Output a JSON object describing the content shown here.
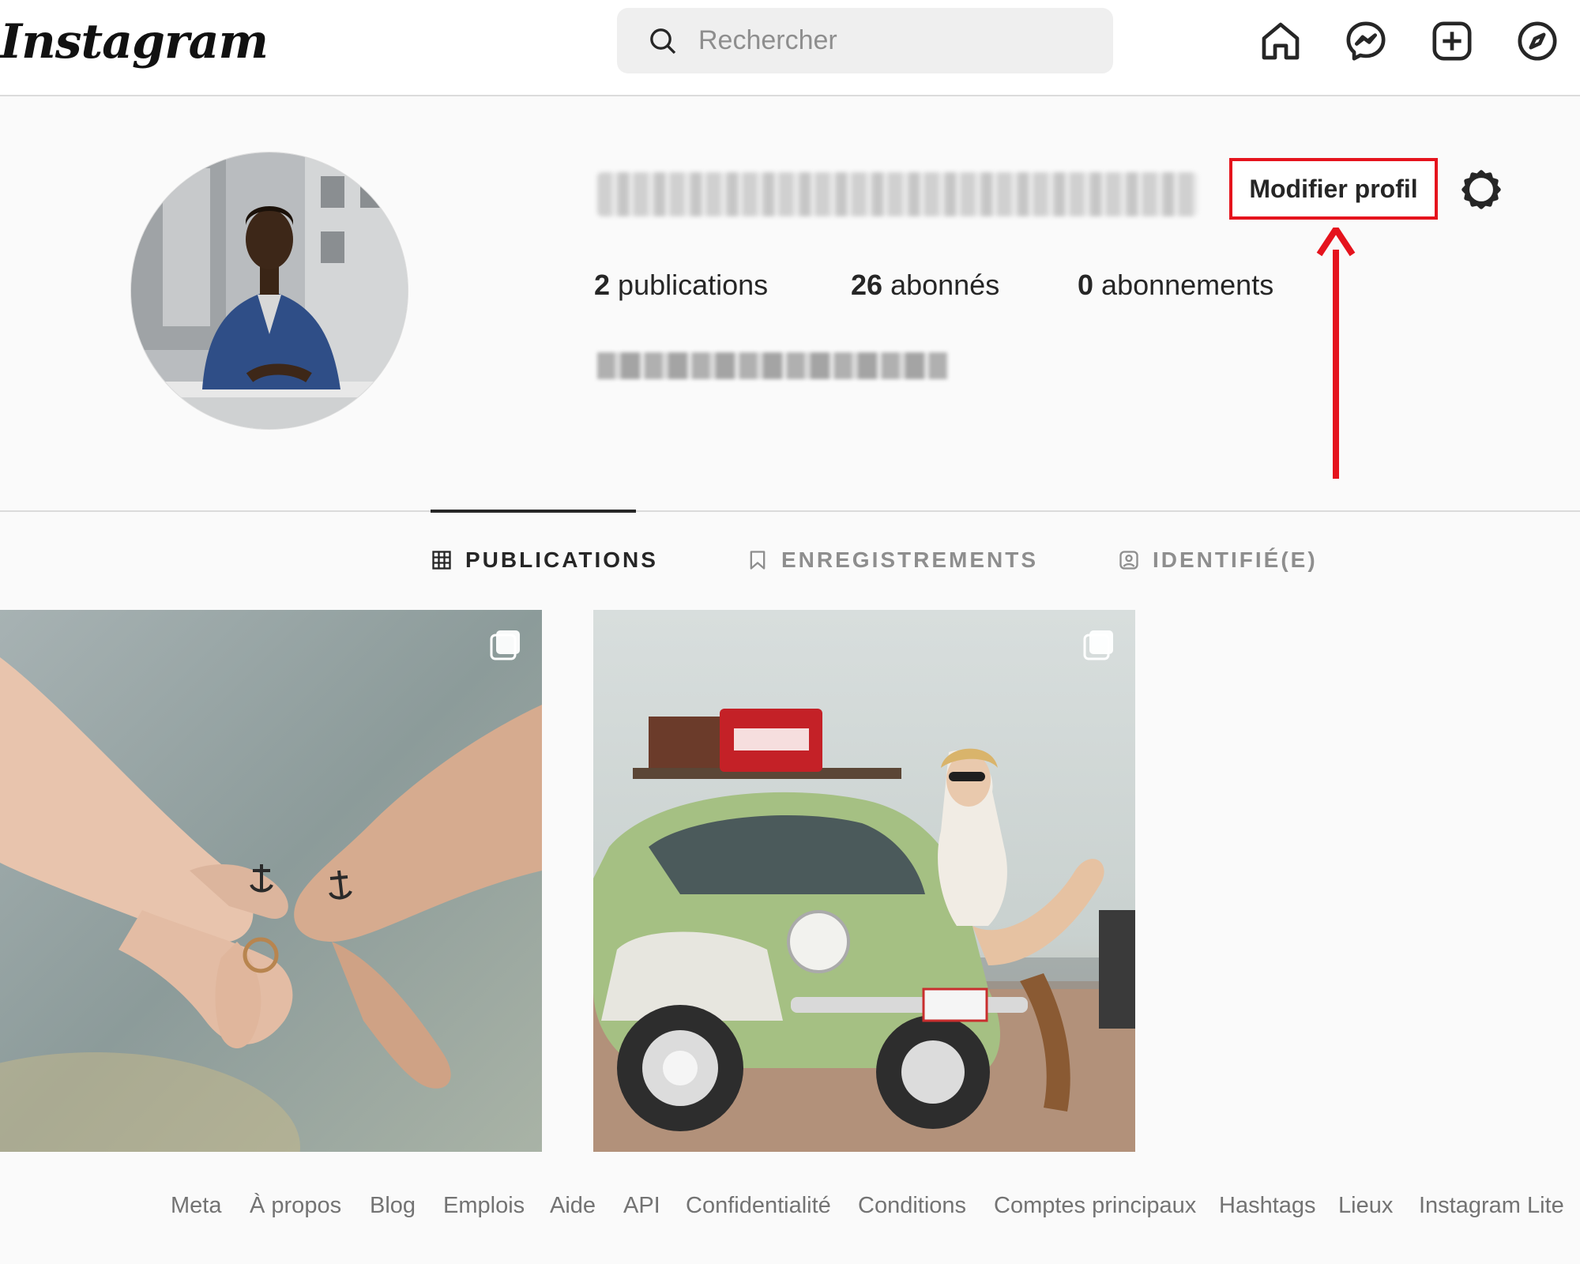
{
  "header": {
    "logo_text": "Instagram",
    "search_placeholder": "Rechercher",
    "nav_icons": [
      "home-icon",
      "messenger-icon",
      "new-post-icon",
      "explore-icon"
    ]
  },
  "profile": {
    "edit_button_label": "Modifier profil",
    "stats": [
      {
        "count": "2",
        "label": "publications"
      },
      {
        "count": "26",
        "label": "abonnés"
      },
      {
        "count": "0",
        "label": "abonnements"
      }
    ]
  },
  "tabs": [
    {
      "label": "PUBLICATIONS",
      "icon": "grid-icon",
      "active": true
    },
    {
      "label": "ENREGISTREMENTS",
      "icon": "bookmark-icon",
      "active": false
    },
    {
      "label": "IDENTIFIÉ(E)",
      "icon": "tagged-icon",
      "active": false
    }
  ],
  "posts": [
    {
      "type": "carousel",
      "subject": "anchor-tattoo-hands"
    },
    {
      "type": "carousel",
      "subject": "green-beetle-car"
    }
  ],
  "footer": {
    "links": [
      "Meta",
      "À propos",
      "Blog",
      "Emplois",
      "Aide",
      "API",
      "Confidentialité",
      "Conditions",
      "Comptes principaux",
      "Hashtags",
      "Lieux",
      "Instagram Lite"
    ]
  },
  "colors": {
    "highlight": "#e5131d",
    "text_primary": "#262626",
    "text_secondary": "#8e8e8e",
    "background": "#fafafa"
  }
}
